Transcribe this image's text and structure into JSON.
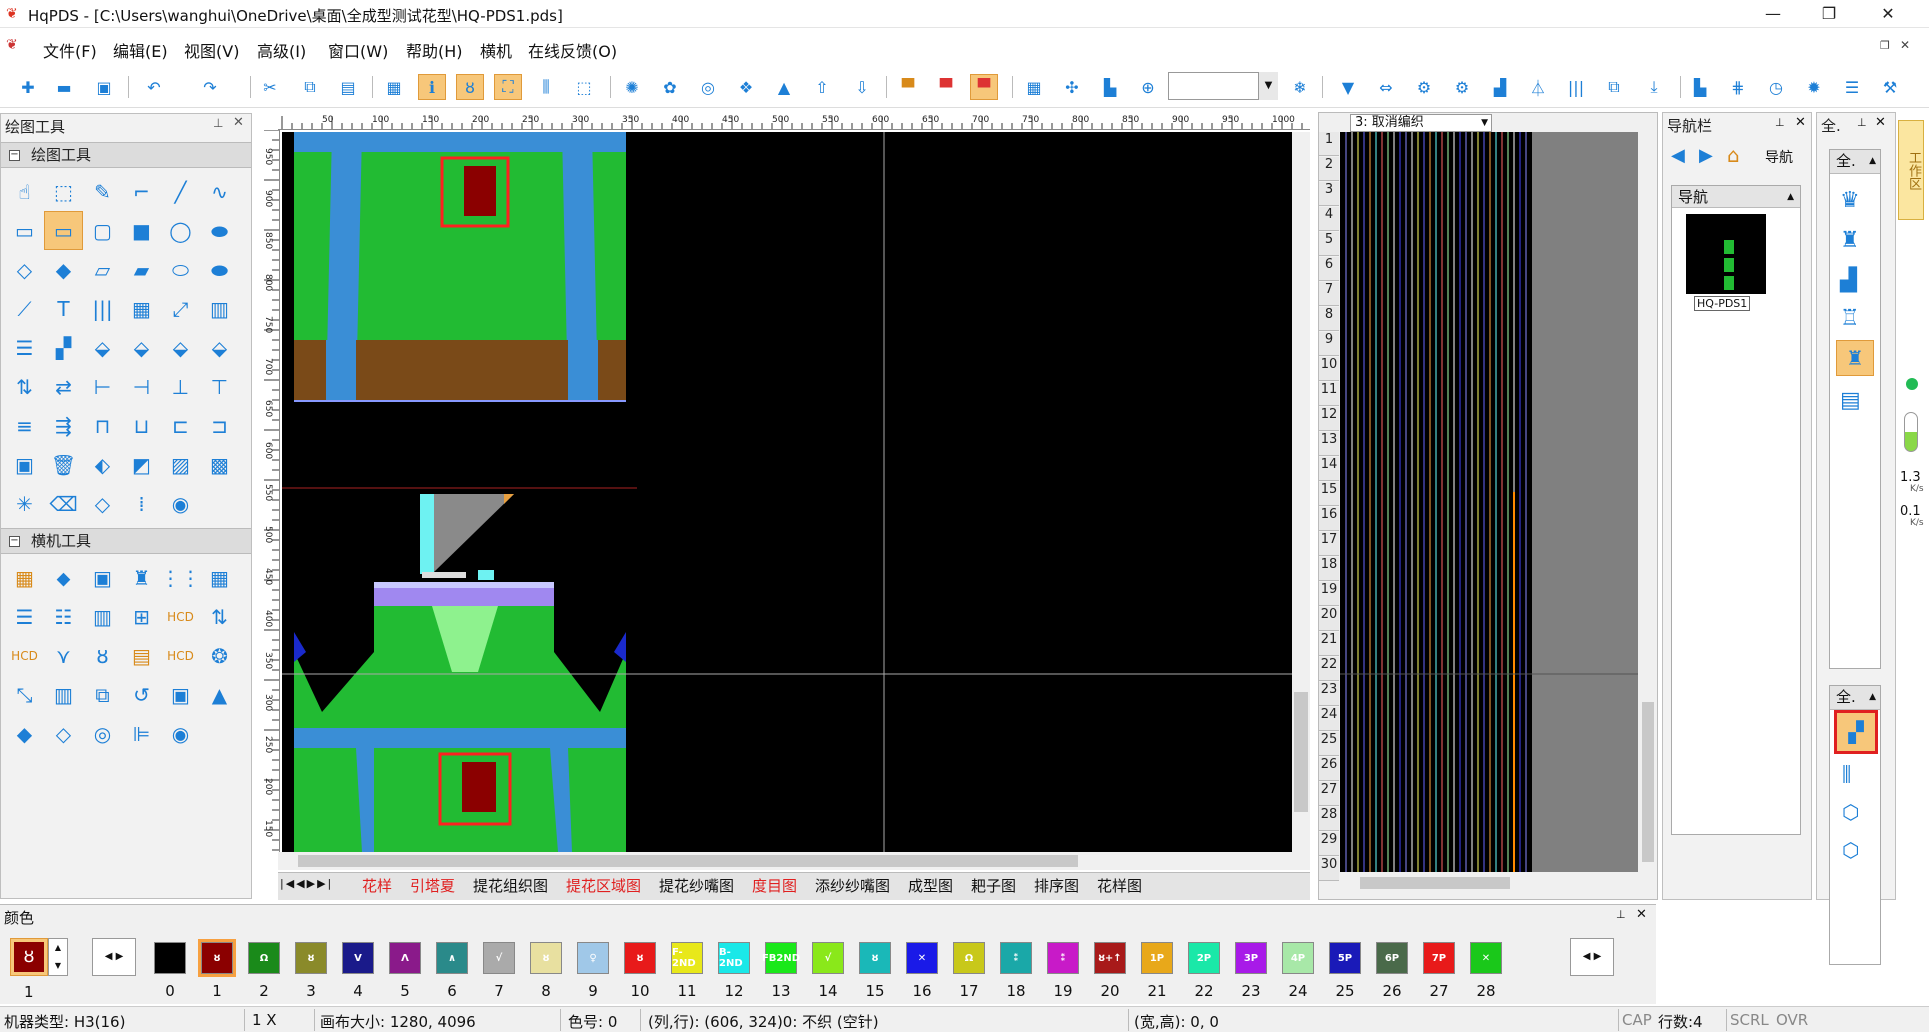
{
  "window": {
    "title": "HqPDS - [C:\\Users\\wanghui\\OneDrive\\桌面\\全成型测试花型\\HQ-PDS1.pds]",
    "minimize": "—",
    "maximize": "❐",
    "close": "✕"
  },
  "menu": [
    "文件(F)",
    "编辑(E)",
    "视图(V)",
    "高级(I)",
    "窗口(W)",
    "帮助(H)",
    "横机",
    "在线反馈(O)"
  ],
  "left_panel": {
    "title": "绘图工具",
    "sections": [
      "绘图工具",
      "横机工具"
    ]
  },
  "ruler_ticks": [
    "50",
    "100",
    "150",
    "200",
    "250",
    "300",
    "350",
    "400",
    "450",
    "500",
    "550",
    "600",
    "650",
    "700",
    "750",
    "800",
    "850",
    "900",
    "950",
    "1000"
  ],
  "ruler_side_ticks": [
    "950",
    "900",
    "850",
    "800",
    "750",
    "700",
    "650",
    "600",
    "550",
    "500",
    "450",
    "400",
    "350",
    "300",
    "250",
    "200",
    "150"
  ],
  "right_view": {
    "dropdown": "3: 取消编织",
    "row_numbers": [
      "1",
      "2",
      "3",
      "4",
      "5",
      "6",
      "7",
      "8",
      "9",
      "10",
      "11",
      "12",
      "13",
      "14",
      "15",
      "16",
      "17",
      "18",
      "19",
      "20",
      "21",
      "22",
      "23",
      "24",
      "25",
      "26",
      "27",
      "28",
      "29",
      "30"
    ]
  },
  "nav_panel": {
    "title": "导航栏",
    "label": "导航",
    "sub_title": "导航",
    "thumb_label": "HQ-PDS1"
  },
  "side_strip": {
    "title": "全.",
    "combo1": "全.",
    "combo2": "全.",
    "speed_up": "1.3",
    "speed_up_unit": "K/s",
    "speed_down": "0.1",
    "speed_down_unit": "K/s",
    "vertical_tab": "工作区"
  },
  "tabs": [
    {
      "label": "花样",
      "color": "#e02020"
    },
    {
      "label": "引塔夏",
      "color": "#e02020"
    },
    {
      "label": "提花组织图",
      "color": "#111111"
    },
    {
      "label": "提花区域图",
      "color": "#e02020"
    },
    {
      "label": "提花纱嘴图",
      "color": "#111111"
    },
    {
      "label": "度目图",
      "color": "#e02020"
    },
    {
      "label": "添纱纱嘴图",
      "color": "#111111"
    },
    {
      "label": "成型图",
      "color": "#111111"
    },
    {
      "label": "耙子图",
      "color": "#111111"
    },
    {
      "label": "排序图",
      "color": "#111111"
    },
    {
      "label": "花样图",
      "color": "#111111"
    }
  ],
  "color_panel": {
    "title": "颜色",
    "current_index": "1",
    "swatches": [
      {
        "n": "0",
        "bg": "#000000",
        "g": ""
      },
      {
        "n": "1",
        "bg": "#8b0000",
        "g": "ȣ"
      },
      {
        "n": "2",
        "bg": "#1a8a1a",
        "g": "Ω"
      },
      {
        "n": "3",
        "bg": "#8a8a2a",
        "g": "ȣ"
      },
      {
        "n": "4",
        "bg": "#1a1a8a",
        "g": "V"
      },
      {
        "n": "5",
        "bg": "#8a1a8a",
        "g": "Λ"
      },
      {
        "n": "6",
        "bg": "#2a8a8a",
        "g": "∧"
      },
      {
        "n": "7",
        "bg": "#aaaaaa",
        "g": "√"
      },
      {
        "n": "8",
        "bg": "#e8e0a0",
        "g": "ȣ"
      },
      {
        "n": "9",
        "bg": "#a0c8e8",
        "g": "♀"
      },
      {
        "n": "10",
        "bg": "#e81a1a",
        "g": "ȣ"
      },
      {
        "n": "11",
        "bg": "#e8e81a",
        "g": "F-2ND"
      },
      {
        "n": "12",
        "bg": "#1ae8e8",
        "g": "B-2ND"
      },
      {
        "n": "13",
        "bg": "#1ae81a",
        "g": "FB2ND"
      },
      {
        "n": "14",
        "bg": "#8ae81a",
        "g": "√"
      },
      {
        "n": "15",
        "bg": "#1ab8b8",
        "g": "ȣ"
      },
      {
        "n": "16",
        "bg": "#1a1ae8",
        "g": "✕"
      },
      {
        "n": "17",
        "bg": "#c8c81a",
        "g": "Ω"
      },
      {
        "n": "18",
        "bg": "#1aa8a8",
        "g": "⁑"
      },
      {
        "n": "19",
        "bg": "#c81ac8",
        "g": "⁑"
      },
      {
        "n": "20",
        "bg": "#a81a1a",
        "g": "ȣ+↑"
      },
      {
        "n": "21",
        "bg": "#e8a81a",
        "g": "1P"
      },
      {
        "n": "22",
        "bg": "#1ae8a8",
        "g": "2P"
      },
      {
        "n": "23",
        "bg": "#a81ae8",
        "g": "3P"
      },
      {
        "n": "24",
        "bg": "#a8e8a8",
        "g": "4P"
      },
      {
        "n": "25",
        "bg": "#1a1ab8",
        "g": "5P"
      },
      {
        "n": "26",
        "bg": "#4a6a4a",
        "g": "6P"
      },
      {
        "n": "27",
        "bg": "#e81a1a",
        "g": "7P"
      },
      {
        "n": "28",
        "bg": "#1ac81a",
        "g": "✕"
      }
    ]
  },
  "status": {
    "machine": "机器类型: H3(16)",
    "zoom": "1 X",
    "canvas_size": "画布大小: 1280, 4096",
    "color_no": "色号: 0",
    "position": "(列,行): (606, 324)0: 不织 (空针)",
    "size": "(宽,高): 0, 0",
    "cap": "CAP",
    "rows": "行数:4",
    "scrl": "SCRL",
    "ovr": "OVR"
  }
}
